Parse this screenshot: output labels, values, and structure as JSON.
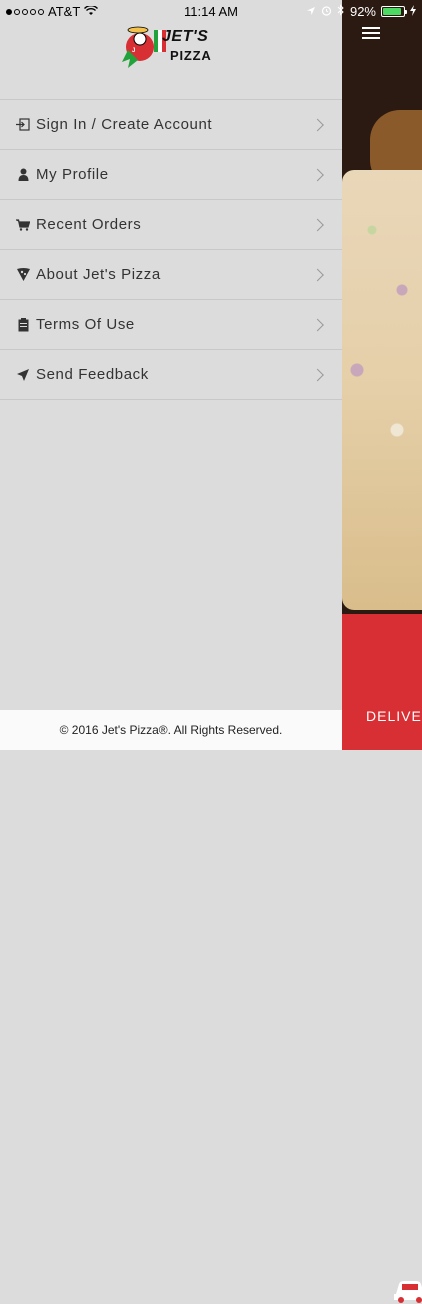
{
  "status_bar": {
    "carrier": "AT&T",
    "time": "11:14 AM",
    "battery_percent": "92%"
  },
  "brand": {
    "logo_text_line1": "JET'S",
    "logo_text_line2": "PIZZA"
  },
  "menu": {
    "items": [
      {
        "label": "Sign In / Create Account",
        "icon": "sign-in-icon"
      },
      {
        "label": "My Profile",
        "icon": "person-icon"
      },
      {
        "label": "Recent Orders",
        "icon": "cart-icon"
      },
      {
        "label": "About Jet's Pizza",
        "icon": "pizza-icon"
      },
      {
        "label": "Terms Of Use",
        "icon": "clipboard-icon"
      },
      {
        "label": "Send Feedback",
        "icon": "send-icon"
      }
    ]
  },
  "footer": {
    "copyright": "© 2016 Jet's Pizza®. All Rights Reserved."
  },
  "background_panel": {
    "delivery_text": "DELIVE"
  },
  "colors": {
    "drawer_bg": "#dcdcdc",
    "delivery_red": "#d72f33",
    "battery_green": "#4cd964"
  }
}
